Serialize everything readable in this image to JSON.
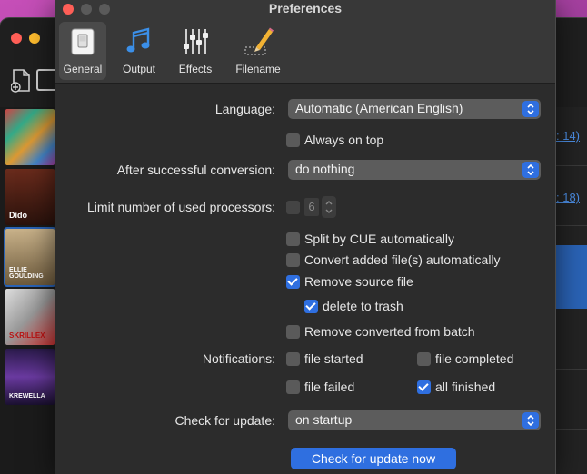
{
  "window_title": "Preferences",
  "toolbar": {
    "tabs": [
      {
        "label": "General",
        "icon": "switch-icon",
        "selected": true
      },
      {
        "label": "Output",
        "icon": "music-note-icon",
        "selected": false
      },
      {
        "label": "Effects",
        "icon": "sliders-icon",
        "selected": false
      },
      {
        "label": "Filename",
        "icon": "pencil-icon",
        "selected": false
      }
    ]
  },
  "general": {
    "language_label": "Language:",
    "language_value": "Automatic (American English)",
    "always_on_top": {
      "label": "Always on top",
      "checked": false
    },
    "after_conversion_label": "After successful conversion:",
    "after_conversion_value": "do nothing",
    "limit_processors_label": "Limit number of used processors:",
    "limit_processors_checked": false,
    "processors_value": "6",
    "split_cue": {
      "label": "Split by CUE automatically",
      "checked": false
    },
    "convert_added": {
      "label": "Convert added file(s) automatically",
      "checked": false
    },
    "remove_source": {
      "label": "Remove source file",
      "checked": true
    },
    "delete_to_trash": {
      "label": "delete to trash",
      "checked": true
    },
    "remove_converted": {
      "label": "Remove converted from batch",
      "checked": false
    },
    "notifications_label": "Notifications:",
    "notif_file_started": {
      "label": "file started",
      "checked": false
    },
    "notif_file_completed": {
      "label": "file completed",
      "checked": false
    },
    "notif_file_failed": {
      "label": "file failed",
      "checked": false
    },
    "notif_all_finished": {
      "label": "all finished",
      "checked": true
    },
    "check_update_label": "Check for update:",
    "check_update_value": "on startup",
    "check_update_button": "Check for update now"
  },
  "background_window": {
    "thumbnails": [
      {
        "label": ""
      },
      {
        "label": "Dido"
      },
      {
        "label": "ELLIE GOULDING"
      },
      {
        "label": "SKRILLEX"
      },
      {
        "label": "KREWELLA"
      }
    ],
    "links": [
      ": 14)",
      ": 18)"
    ]
  },
  "colors": {
    "accent": "#2f6fe0",
    "window_bg": "#2c2c2c",
    "close": "#ff5f57",
    "minimize": "#febc2e"
  }
}
